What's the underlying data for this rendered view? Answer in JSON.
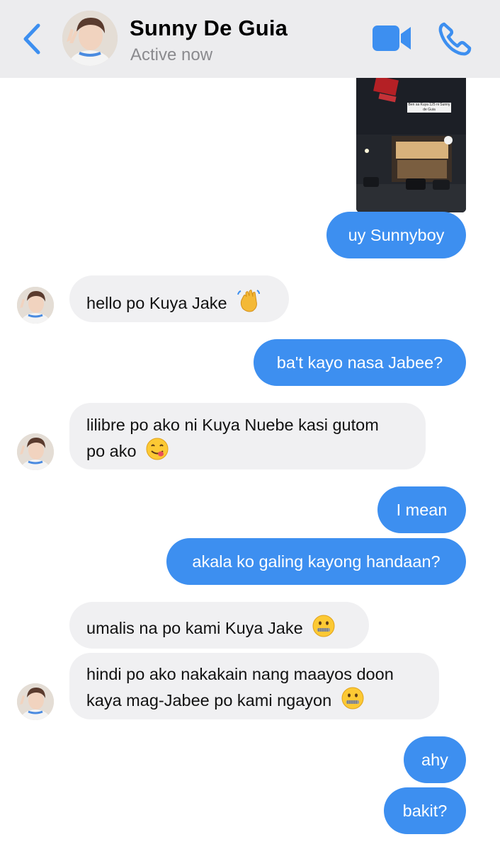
{
  "header": {
    "contact_name": "Sunny De Guia",
    "status": "Active now",
    "back_icon": "chevron-left-icon",
    "video_icon": "video-camera-icon",
    "call_icon": "phone-icon",
    "accent_color": "#3d8ff0"
  },
  "shared_photo": {
    "caption": "Ben sa Kuya 125 ni Sunny de Guia"
  },
  "messages": [
    {
      "sender": "me",
      "text": "uy Sunnyboy"
    },
    {
      "sender": "contact",
      "text": "hello po Kuya Jake",
      "emoji": "waving-hand-emoji"
    },
    {
      "sender": "me",
      "text": "ba't kayo nasa Jabee?"
    },
    {
      "sender": "contact",
      "line1": "lilibre po ako ni Kuya Nuebe kasi gutom",
      "line2": "po ako",
      "emoji": "savoring-face-emoji"
    },
    {
      "sender": "me",
      "text": "I mean"
    },
    {
      "sender": "me",
      "text": "akala ko galing kayong handaan?"
    },
    {
      "sender": "contact",
      "text": "umalis na po kami Kuya Jake",
      "emoji": "zipper-mouth-emoji"
    },
    {
      "sender": "contact",
      "line1": "hindi po ako nakakain nang maayos doon",
      "line2": "kaya mag-Jabee po kami ngayon",
      "emoji": "zipper-mouth-emoji"
    },
    {
      "sender": "me",
      "text": "ahy"
    },
    {
      "sender": "me",
      "text": "bakit?"
    }
  ]
}
